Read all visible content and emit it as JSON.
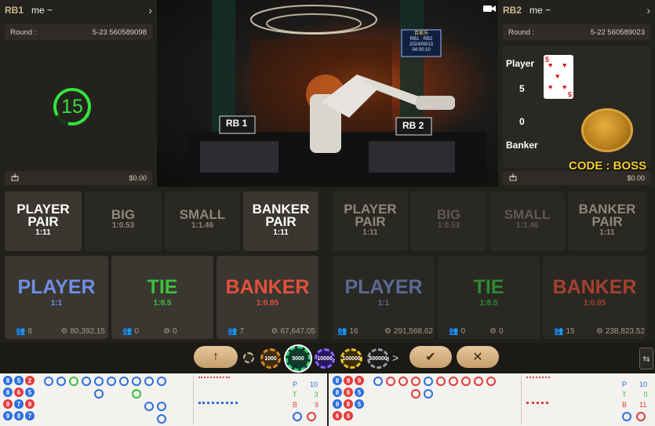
{
  "left_table": {
    "code": "RB1",
    "name": "me ~",
    "round_label": "Round :",
    "round_value": "5-23 560589098",
    "timer": "15",
    "balance": "$0.00"
  },
  "right_table": {
    "code": "RB2",
    "name": "me ~",
    "round_label": "Round :",
    "round_value": "5-22 560589023",
    "player_label": "Player",
    "player_score": "5",
    "banker_label": "Banker",
    "banker_score": "0",
    "card_rank": "5",
    "promo_text": "CODE : BOSS",
    "balance": "$0.00"
  },
  "video": {
    "sign_title": "百家乐",
    "sign_line1": "RB1 · RB2",
    "sign_line2": "2024/09/13",
    "sign_line3": "04:00:10",
    "tag_left": "RB 1",
    "tag_right": "RB 2"
  },
  "bets_left": {
    "player_pair": {
      "label1": "PLAYER",
      "label2": "PAIR",
      "odds": "1:11"
    },
    "big": {
      "label": "BIG",
      "odds": "1:0.53"
    },
    "small": {
      "label": "SMALL",
      "odds": "1:1.46"
    },
    "banker_pair": {
      "label1": "BANKER",
      "label2": "PAIR",
      "odds": "1:11"
    },
    "player": {
      "label": "PLAYER",
      "odds": "1:1",
      "users": "8",
      "amount": "80,392.15"
    },
    "tie": {
      "label": "TIE",
      "odds": "1:8.5",
      "users": "0",
      "amount": "0"
    },
    "banker": {
      "label": "BANKER",
      "odds": "1:0.95",
      "users": "7",
      "amount": "67,647.05"
    }
  },
  "bets_right": {
    "player_pair": {
      "label1": "PLAYER",
      "label2": "PAIR",
      "odds": "1:11"
    },
    "big": {
      "label": "BIG",
      "odds": "1:0.53"
    },
    "small": {
      "label": "SMALL",
      "odds": "1:1.46"
    },
    "banker_pair": {
      "label1": "BANKER",
      "label2": "PAIR",
      "odds": "1:11"
    },
    "player": {
      "label": "PLAYER",
      "odds": "1:1",
      "users": "16",
      "amount": "291,568.62"
    },
    "tie": {
      "label": "TIE",
      "odds": "1:8.5",
      "users": "0",
      "amount": "0"
    },
    "banker": {
      "label": "BANKER",
      "odds": "1:0.95",
      "users": "15",
      "amount": "238,823.52"
    }
  },
  "chips": {
    "c1": "1000",
    "c2": "5000",
    "c3": "10000",
    "c4": "100000",
    "c5": "500000",
    "more": ">"
  },
  "road_left": {
    "bead": [
      [
        "8",
        "5",
        "2"
      ],
      [
        "8",
        "6",
        "5"
      ],
      [
        "9",
        "7",
        "9"
      ],
      [
        "9",
        "8",
        "7"
      ]
    ],
    "stats": {
      "p_label": "P",
      "p_value": "10",
      "t_label": "T",
      "t_value": "3",
      "b_label": "B",
      "b_value": "9"
    }
  },
  "road_right": {
    "bead": [
      [
        "8",
        "9",
        "9"
      ],
      [
        "8",
        "6",
        "5"
      ],
      [
        "9",
        "8",
        "5"
      ],
      [
        "6",
        "6",
        ""
      ]
    ],
    "stats": {
      "p_label": "P",
      "p_value": "10",
      "t_label": "T",
      "t_value": "0",
      "b_label": "B",
      "b_value": "11"
    }
  },
  "colors": {
    "player": "#6f8fe6",
    "tie": "#3cbf3c",
    "banker": "#e4513b",
    "gold": "#d9b77f",
    "timer_green": "#35e23c"
  }
}
